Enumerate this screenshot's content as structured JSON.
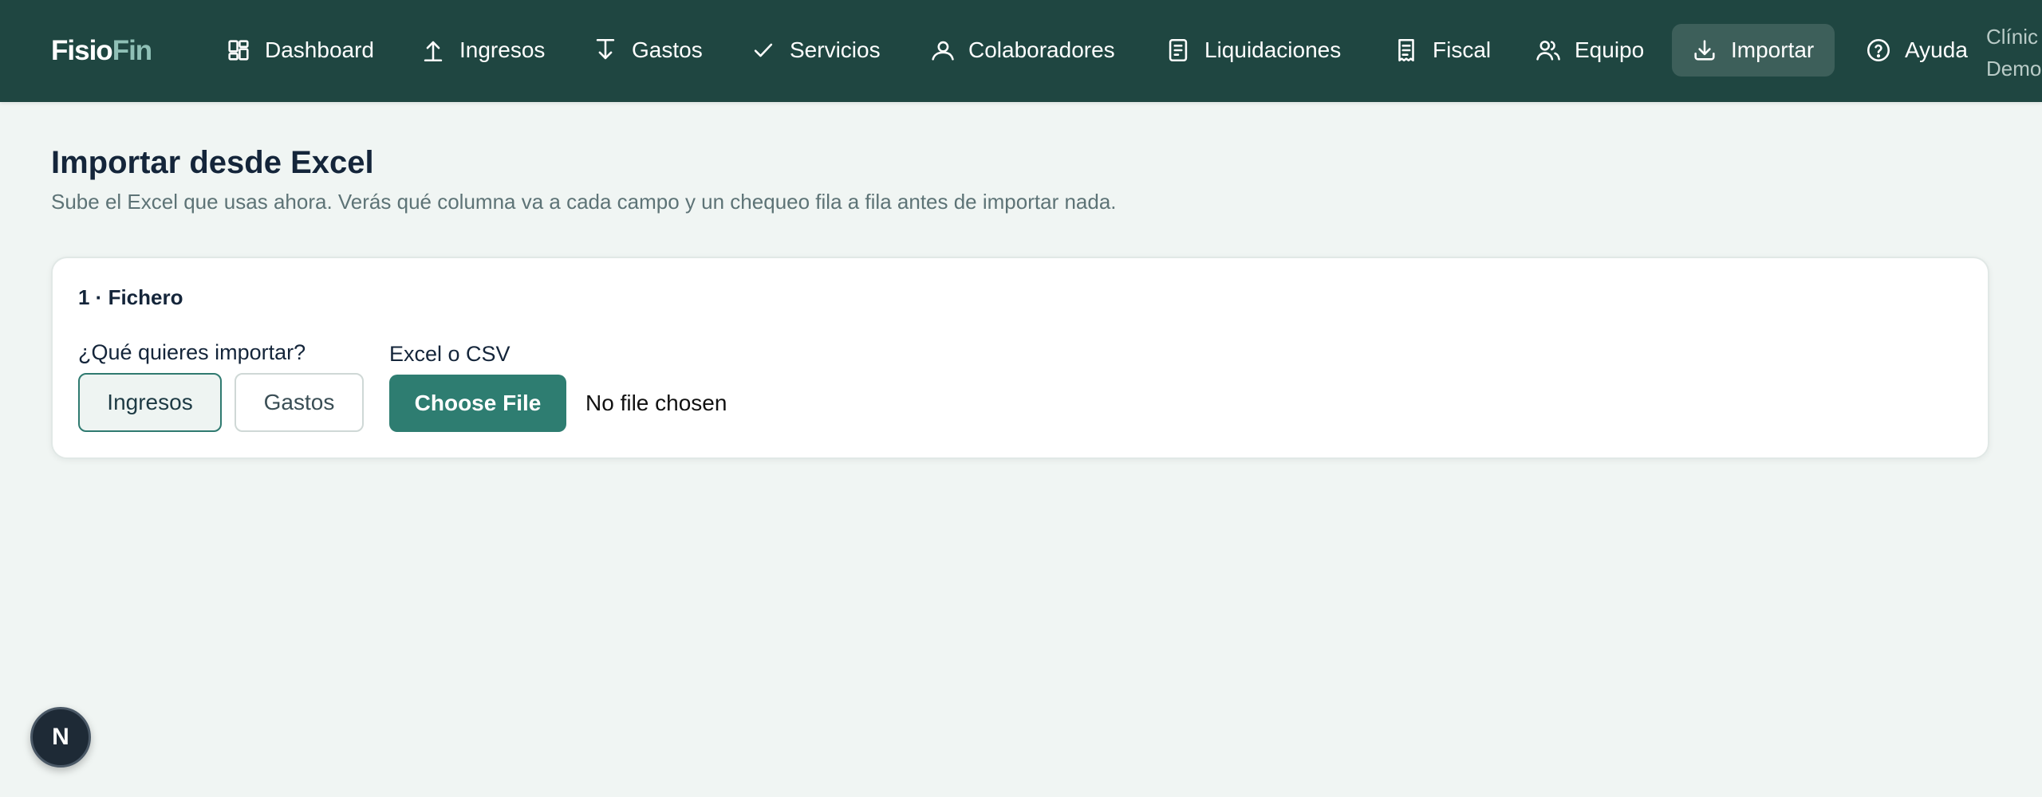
{
  "app": {
    "logo_part1": "Fisio",
    "logo_part2": "Fin",
    "brand_color": "#1f4641",
    "accent_color": "#2e7d71"
  },
  "nav": {
    "items": [
      {
        "label": "Dashboard",
        "icon": "dashboard-grid-icon"
      },
      {
        "label": "Ingresos",
        "icon": "arrow-up-icon"
      },
      {
        "label": "Gastos",
        "icon": "arrow-down-icon"
      },
      {
        "label": "Servicios",
        "icon": "check-icon"
      },
      {
        "label": "Colaboradores",
        "icon": "user-icon"
      },
      {
        "label": "Liquidaciones",
        "icon": "document-icon"
      },
      {
        "label": "Fiscal",
        "icon": "receipt-icon"
      },
      {
        "label": "Equipo",
        "icon": "users-icon"
      },
      {
        "label": "Importar",
        "icon": "download-icon",
        "active": true
      },
      {
        "label": "Ayuda",
        "icon": "help-circle-icon"
      }
    ],
    "clinic_line1": "Clínic",
    "clinic_line2": "Demo"
  },
  "page": {
    "title": "Importar desde Excel",
    "subtitle": "Sube el Excel que usas ahora. Verás qué columna va a cada campo y un chequeo fila a fila antes de importar nada."
  },
  "card": {
    "title": "1 · Fichero",
    "type_label": "¿Qué quieres importar?",
    "type_options": [
      "Ingresos",
      "Gastos"
    ],
    "type_selected": "Ingresos",
    "file_label": "Excel o CSV",
    "file_button": "Choose File",
    "file_status": "No file chosen"
  },
  "devtools": {
    "badge_letter": "N"
  }
}
